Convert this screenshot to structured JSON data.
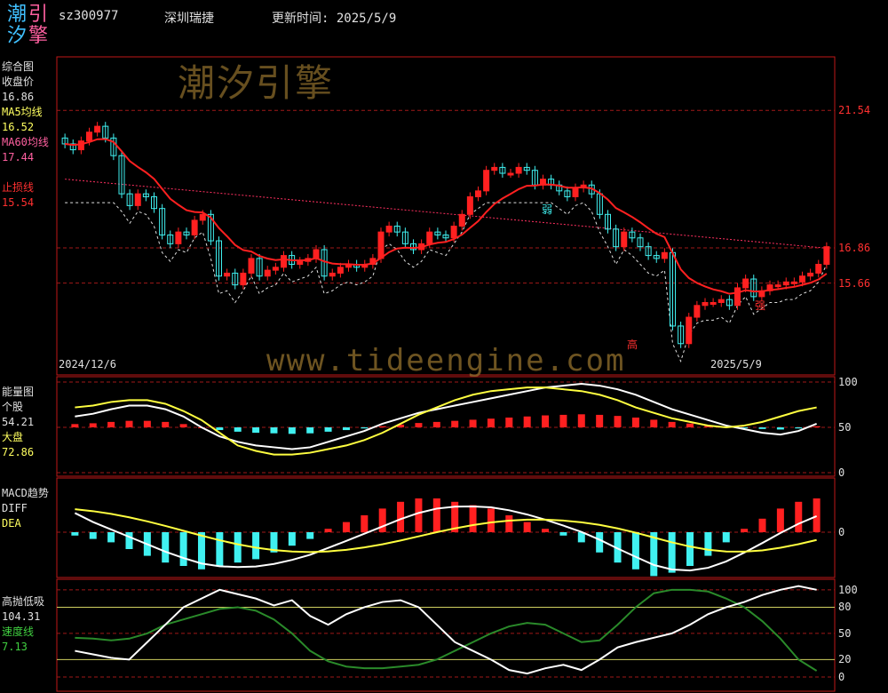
{
  "header": {
    "logo_chars": [
      "潮",
      "引",
      "汐",
      "擎"
    ],
    "code": "sz300977",
    "name": "深圳瑞捷",
    "update_label": "更新时间: 2025/5/9"
  },
  "watermark": {
    "cn": "潮汐引擎",
    "url": "www.tideengine.com"
  },
  "panel1": {
    "labels": [
      {
        "text": "综合图",
        "color": "#e0e0e0"
      },
      {
        "text": "收盘价",
        "color": "#e0e0e0"
      },
      {
        "text": "16.86",
        "color": "#e0e0e0"
      },
      {
        "text": "MA5均线",
        "color": "#ffff60"
      },
      {
        "text": "16.52",
        "color": "#ffff60"
      },
      {
        "text": "MA60均线",
        "color": "#ff60a0"
      },
      {
        "text": "17.44",
        "color": "#ff60a0"
      },
      {
        "text": "",
        "color": "#000"
      },
      {
        "text": "止损线",
        "color": "#ff3030"
      },
      {
        "text": "15.54",
        "color": "#ff3030"
      }
    ],
    "axis": [
      "21.54",
      "16.86",
      "15.66"
    ],
    "date_start": "2024/12/6",
    "date_end": "2025/5/9",
    "markers": {
      "weak": "弱",
      "high": "高",
      "strong": "强"
    }
  },
  "panel2": {
    "labels": [
      {
        "text": "能量图",
        "color": "#e0e0e0"
      },
      {
        "text": "个股",
        "color": "#e0e0e0"
      },
      {
        "text": "54.21",
        "color": "#e0e0e0"
      },
      {
        "text": "大盘",
        "color": "#ffff60"
      },
      {
        "text": "72.86",
        "color": "#ffff60"
      }
    ],
    "axis": [
      "100",
      "50",
      "0"
    ]
  },
  "panel3": {
    "labels": [
      {
        "text": "MACD趋势",
        "color": "#e0e0e0"
      },
      {
        "text": "DIFF",
        "color": "#e0e0e0"
      },
      {
        "text": "DEA",
        "color": "#ffff60"
      }
    ],
    "axis": [
      "0"
    ]
  },
  "panel4": {
    "labels": [
      {
        "text": "高抛低吸",
        "color": "#e0e0e0"
      },
      {
        "text": "104.31",
        "color": "#e0e0e0"
      },
      {
        "text": "速度线",
        "color": "#40d040"
      },
      {
        "text": "7.13",
        "color": "#40d040"
      }
    ],
    "axis": [
      "100",
      "80",
      "50",
      "20",
      "0"
    ]
  },
  "colors": {
    "up": "#ff2020",
    "down": "#40f0f0",
    "ma5": "#ffff40",
    "ma60": "#ff3060",
    "stop": "#ff2020",
    "frame": "#c01818",
    "white": "#ffffff",
    "green": "#2a8a2a",
    "dashgreen": "#3a7a3a"
  },
  "chart_data": {
    "type": "candlestick",
    "x_start": "2024/12/6",
    "x_end": "2025/5/9",
    "y_ticks": [
      21.54,
      16.86,
      15.66
    ],
    "close": [
      20.4,
      20.2,
      20.5,
      20.8,
      21.0,
      20.6,
      20.0,
      18.7,
      18.3,
      18.7,
      18.6,
      18.2,
      17.3,
      17.0,
      17.4,
      17.3,
      17.8,
      18.0,
      17.1,
      15.9,
      16.0,
      15.6,
      16.0,
      16.5,
      15.9,
      16.1,
      16.2,
      16.6,
      16.3,
      16.4,
      16.5,
      16.8,
      15.9,
      16.0,
      16.2,
      16.3,
      16.2,
      16.3,
      16.5,
      17.4,
      17.6,
      17.4,
      17.0,
      16.8,
      17.0,
      17.4,
      17.3,
      17.2,
      17.6,
      18.0,
      18.6,
      18.8,
      19.5,
      19.6,
      19.4,
      19.4,
      19.6,
      19.5,
      19.0,
      19.2,
      19.0,
      18.8,
      18.6,
      18.9,
      19.0,
      18.7,
      18.0,
      17.5,
      16.9,
      17.4,
      17.2,
      16.9,
      16.6,
      16.5,
      16.7,
      14.2,
      13.6,
      14.5,
      14.9,
      15.0,
      15.0,
      15.1,
      14.9,
      15.5,
      15.8,
      15.2,
      15.4,
      15.6,
      15.6,
      15.7,
      15.7,
      15.9,
      16.0,
      16.3,
      16.9
    ],
    "energy_stock": [
      62,
      65,
      70,
      74,
      74,
      70,
      62,
      50,
      40,
      34,
      30,
      28,
      26,
      28,
      34,
      40,
      46,
      54,
      60,
      66,
      70,
      74,
      78,
      82,
      86,
      90,
      94,
      96,
      98,
      96,
      92,
      86,
      78,
      70,
      64,
      58,
      52,
      48,
      44,
      42,
      46,
      54
    ],
    "energy_market": [
      72,
      74,
      78,
      80,
      80,
      76,
      68,
      58,
      44,
      30,
      24,
      20,
      20,
      22,
      26,
      30,
      36,
      44,
      54,
      64,
      72,
      80,
      86,
      90,
      92,
      94,
      94,
      92,
      90,
      86,
      80,
      72,
      66,
      60,
      56,
      52,
      50,
      52,
      56,
      62,
      68,
      72
    ],
    "macd_hist": [
      -0.1,
      -0.2,
      -0.3,
      -0.5,
      -0.7,
      -0.9,
      -1.0,
      -1.1,
      -1.0,
      -0.9,
      -0.8,
      -0.6,
      -0.4,
      -0.2,
      0.1,
      0.3,
      0.5,
      0.7,
      0.9,
      1.0,
      1.0,
      0.9,
      0.8,
      0.7,
      0.5,
      0.3,
      0.1,
      -0.1,
      -0.3,
      -0.6,
      -0.9,
      -1.1,
      -1.3,
      -1.2,
      -1.0,
      -0.7,
      -0.3,
      0.1,
      0.4,
      0.7,
      0.9,
      1.0
    ],
    "gpdx": [
      30,
      26,
      22,
      20,
      40,
      60,
      80,
      90,
      100,
      95,
      90,
      82,
      88,
      70,
      60,
      72,
      80,
      86,
      88,
      80,
      60,
      40,
      30,
      20,
      8,
      4,
      10,
      14,
      8,
      20,
      34,
      40,
      45,
      50,
      60,
      72,
      80,
      86,
      94,
      100,
      104.31,
      100
    ],
    "speed": [
      45,
      44,
      42,
      44,
      50,
      60,
      66,
      72,
      78,
      80,
      76,
      66,
      50,
      30,
      18,
      12,
      10,
      10,
      12,
      14,
      20,
      30,
      40,
      50,
      58,
      62,
      60,
      50,
      40,
      42,
      60,
      80,
      96,
      100,
      100,
      98,
      90,
      80,
      64,
      44,
      20,
      7.13
    ]
  }
}
